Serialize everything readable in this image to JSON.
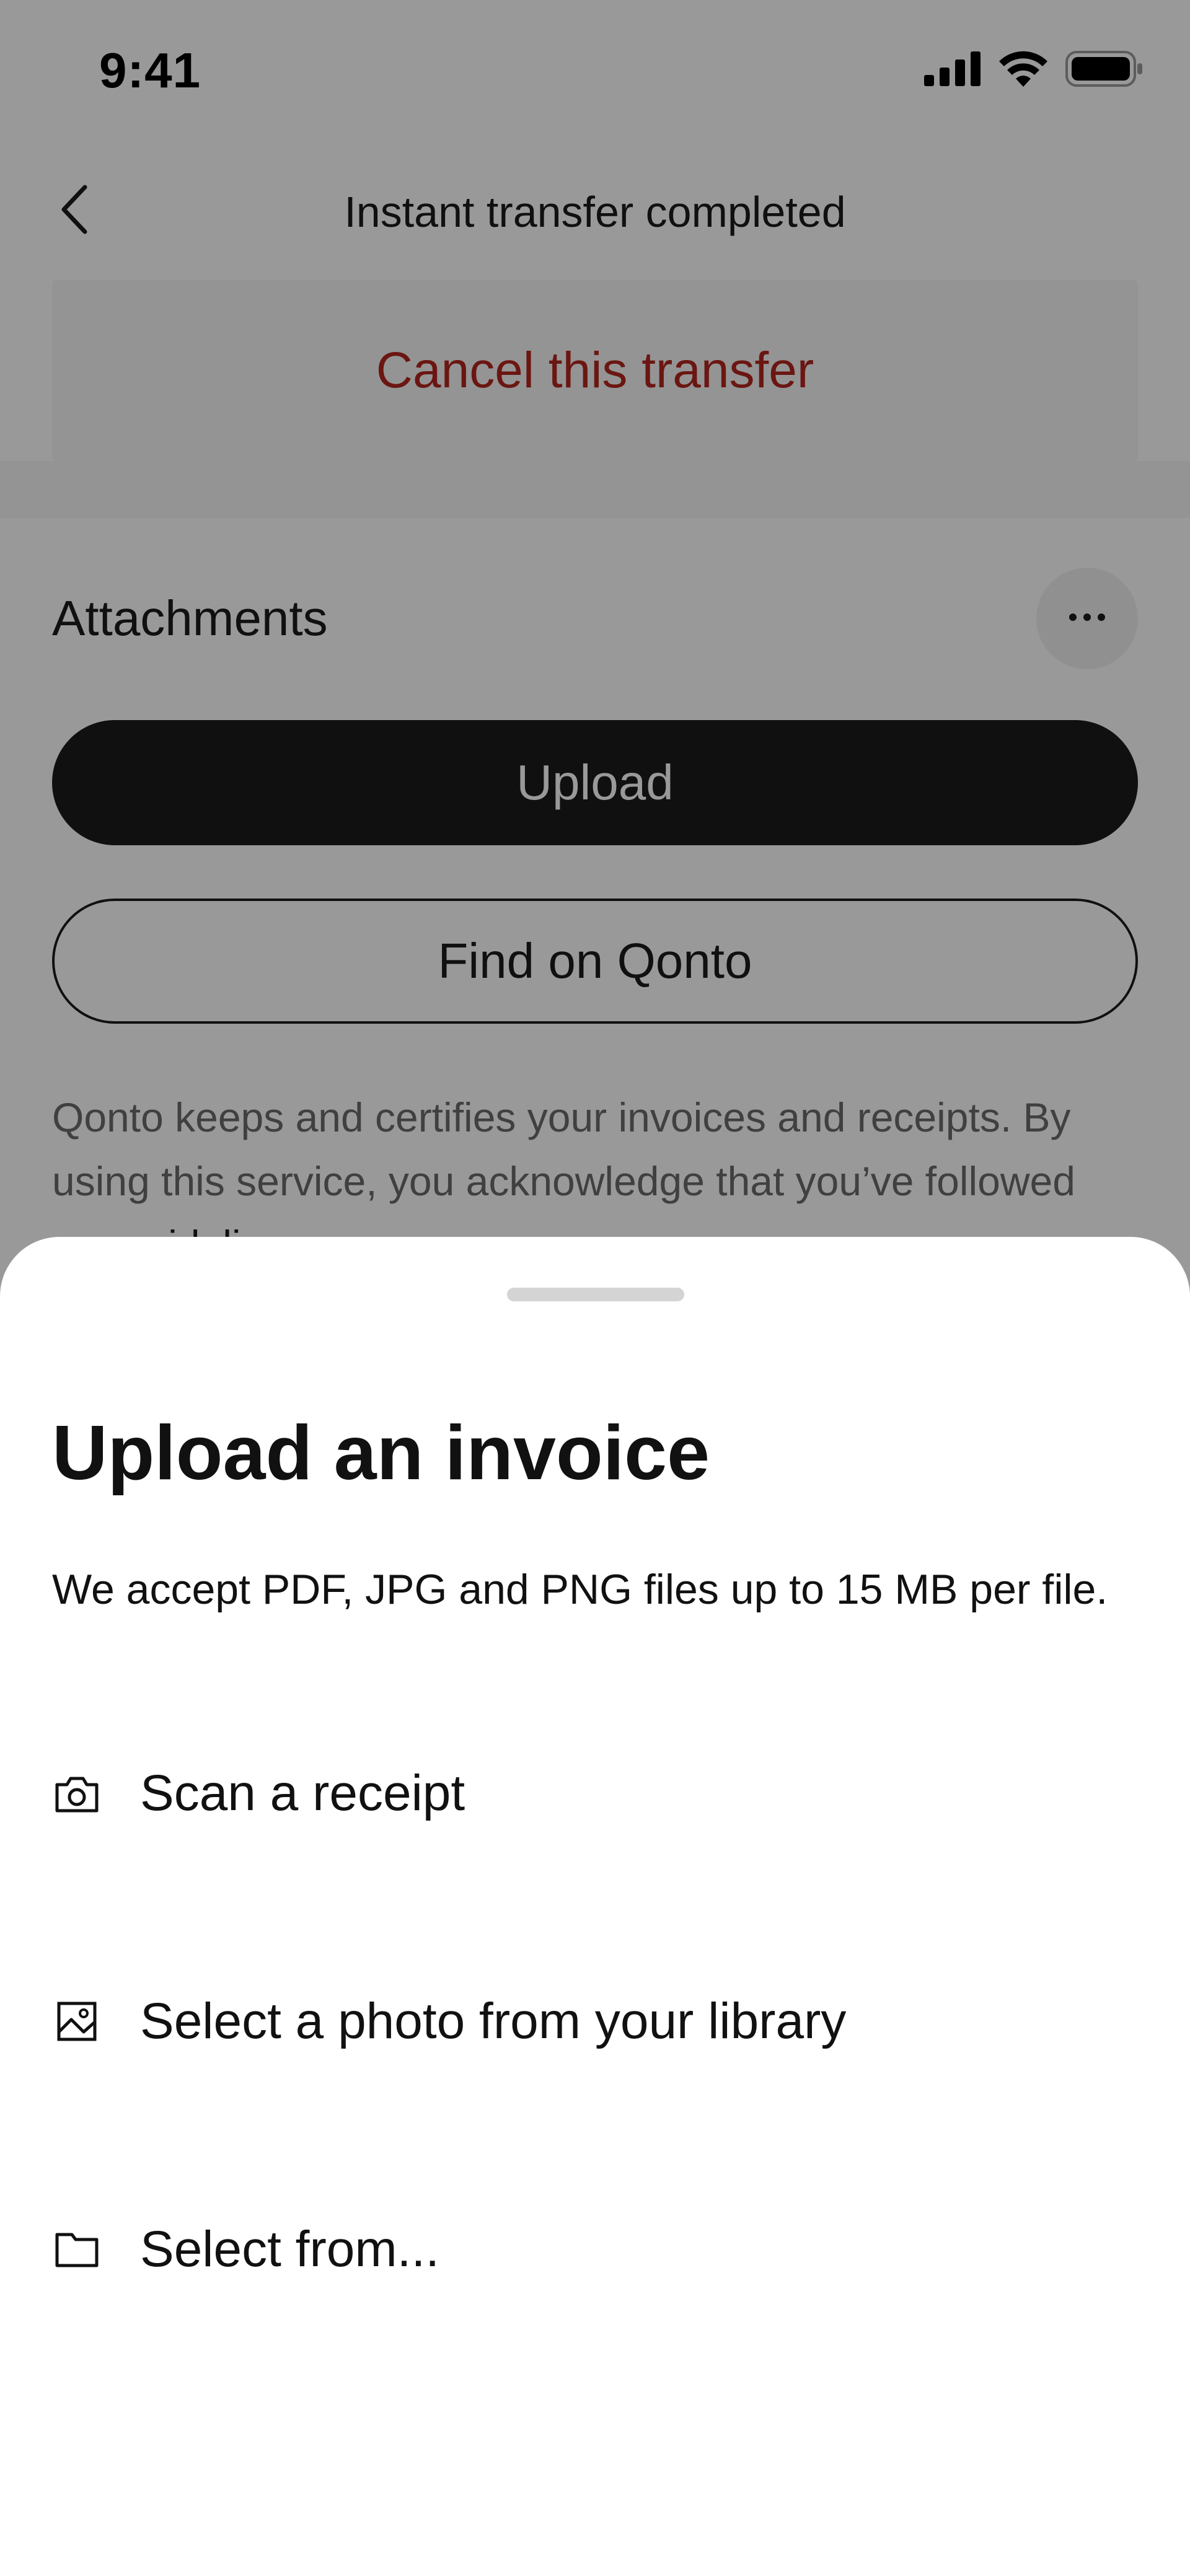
{
  "status_bar": {
    "time": "9:41",
    "icons": [
      "cellular-signal-icon",
      "wifi-icon",
      "battery-icon"
    ]
  },
  "header": {
    "back_icon": "chevron-left-icon",
    "title": "Instant transfer completed"
  },
  "cancel_card": {
    "label": "Cancel this transfer",
    "color": "#b3261e"
  },
  "attachments": {
    "title": "Attachments",
    "more_icon": "ellipsis-icon",
    "upload_label": "Upload",
    "find_label": "Find on Qonto",
    "disclaimer_text": "Qonto keeps and certifies your invoices and receipts. By using this service, you acknowledge that you’ve followed ",
    "disclaimer_link": "our guidelines."
  },
  "sheet": {
    "title": "Upload an invoice",
    "description": "We accept PDF, JPG and PNG files up to 15 MB per file.",
    "options": [
      {
        "icon": "camera-icon",
        "label": "Scan a receipt"
      },
      {
        "icon": "image-icon",
        "label": "Select a photo from your library"
      },
      {
        "icon": "folder-icon",
        "label": "Select from..."
      }
    ]
  },
  "colors": {
    "primary_button": "#1b1b1b",
    "overlay": "rgba(0,0,0,0.4)",
    "sheet_background": "#ffffff"
  }
}
